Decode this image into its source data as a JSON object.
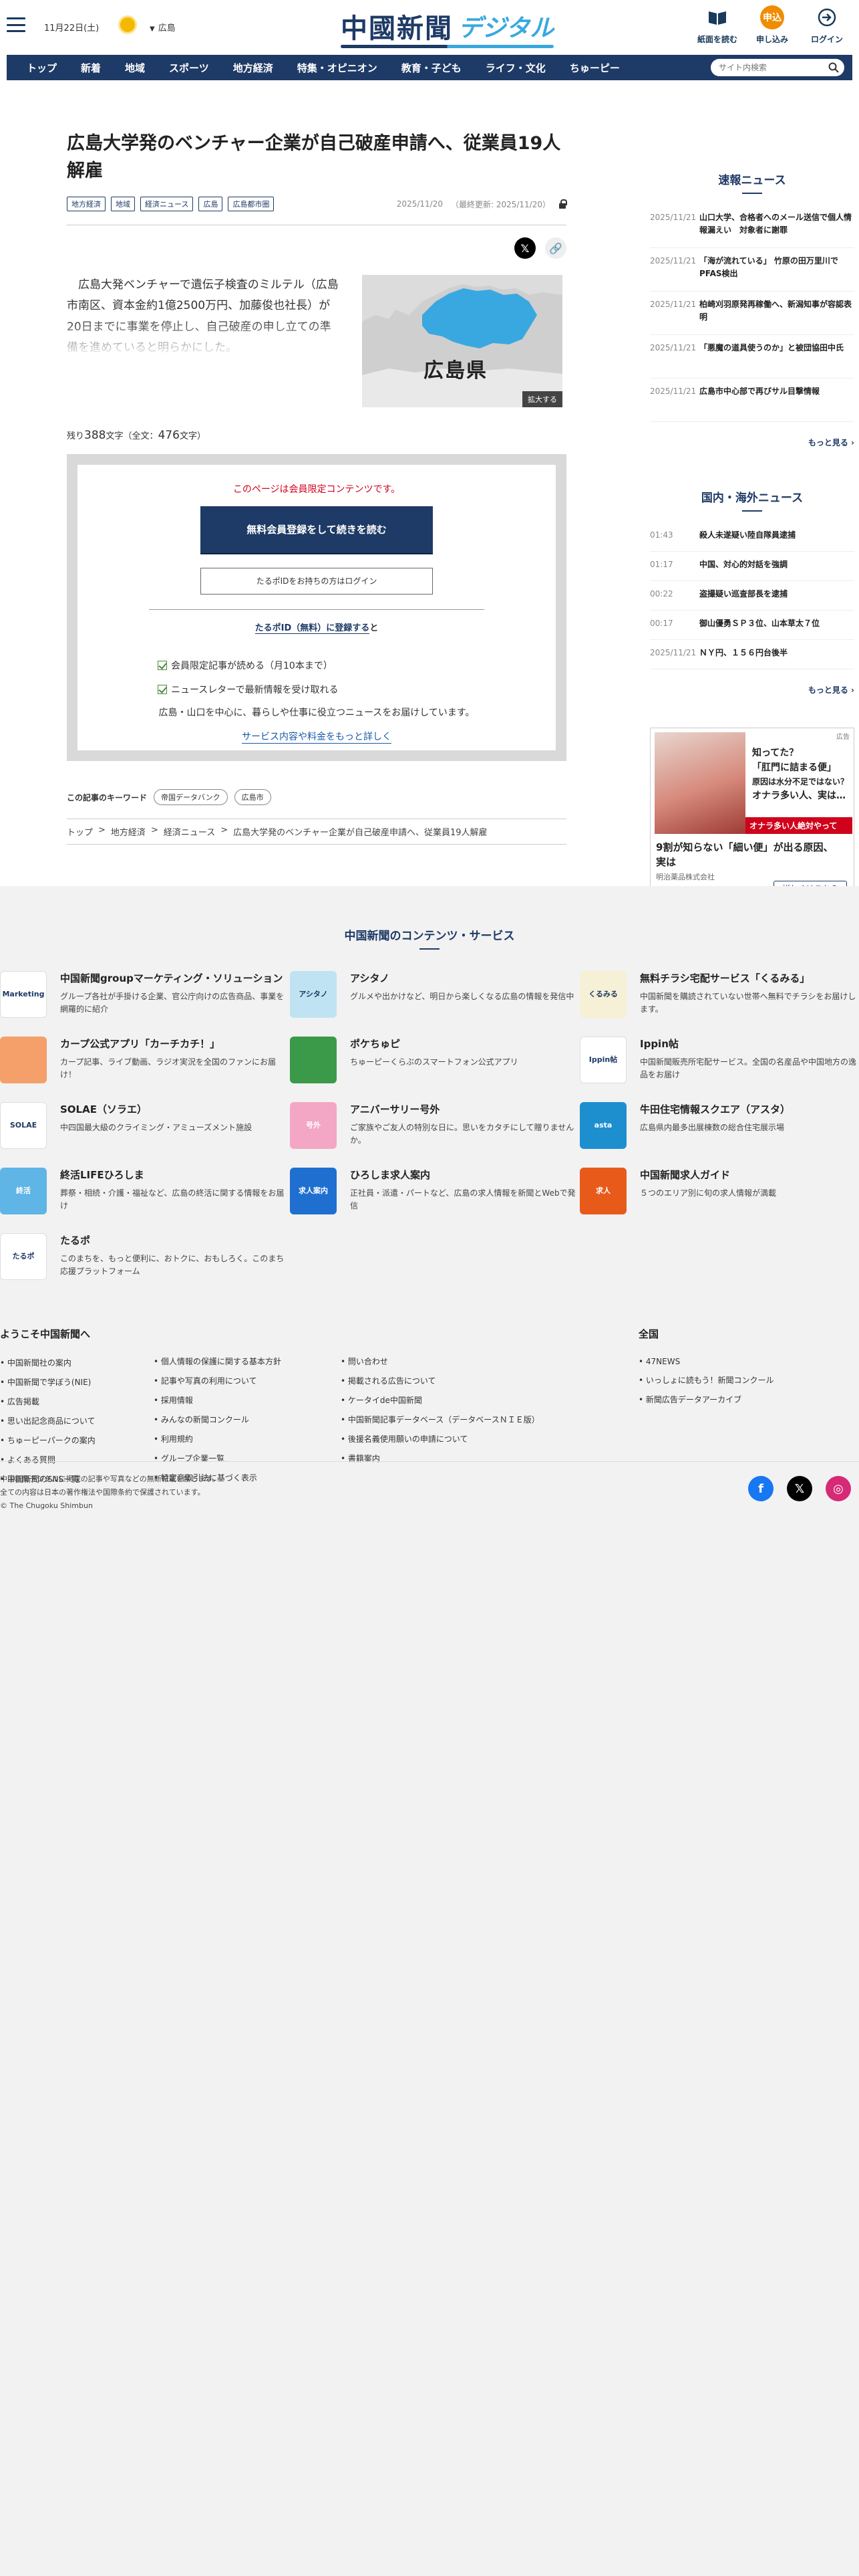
{
  "header": {
    "date": "11月22日(土)",
    "region": "広島",
    "logo_main": "中國新聞",
    "logo_sub": "デジタル",
    "tools": [
      {
        "label": "紙面を読む",
        "icon": "newspaper-icon"
      },
      {
        "label": "申し込み",
        "icon": "subscribe-icon",
        "badge": "申込"
      },
      {
        "label": "ログイン",
        "icon": "login-icon"
      }
    ]
  },
  "nav": {
    "items": [
      "トップ",
      "新着",
      "地域",
      "スポーツ",
      "地方経済",
      "特集・オピニオン",
      "教育・子ども",
      "ライフ・文化",
      "ちゅーピー"
    ],
    "search_placeholder": "サイト内検索"
  },
  "article": {
    "title": "広島大学発のベンチャー企業が自己破産申請へ、従業員19人解雇",
    "tags": [
      "地方経済",
      "地域",
      "経済ニュース",
      "広島",
      "広島都市圏"
    ],
    "date": "2025/11/20",
    "updated": "（最終更新: 2025/11/20）",
    "lead": "広島大発ベンチャーで遺伝子検査のミルテル（広島市南区、資本金約1億2500万円、加藤俊也社長）が20日までに事業を停止し、自己破産の申し立ての準備を進めていると明らかにした。",
    "map_label": "広島県",
    "zoom_label": "拡大する",
    "remaining_prefix": "残り",
    "remaining_count": "388",
    "remaining_mid": "文字（全文：",
    "total_count": "476",
    "remaining_suffix": "文字）",
    "paywall": {
      "notice": "このページは会員限定コンテンツです。",
      "register_button": "無料会員登録をして続きを読む",
      "login_button": "たるポIDをお持ちの方はログイン",
      "id_heading_link": "たるポID（無料）に登録する",
      "id_heading_rest": "と",
      "benefits": [
        "会員限定記事が読める（月10本まで）",
        "ニュースレターで最新情報を受け取れる"
      ],
      "desc": "広島・山口を中心に、暮らしや仕事に役立つニュースをお届けしています。",
      "more_link": "サービス内容や料金をもっと詳しく"
    },
    "keywords_label": "この記事のキーワード",
    "keywords": [
      "帝国データバンク",
      "広島市"
    ],
    "breadcrumb": [
      "トップ",
      "地方経済",
      "経済ニュース",
      "広島大学発のベンチャー企業が自己破産申請へ、従業員19人解雇"
    ]
  },
  "sidebar": {
    "breaking_title": "速報ニュース",
    "breaking": [
      {
        "time": "2025/11/21",
        "headline": "山口大学、合格者へのメール送信で個人情報漏えい　対象者に謝罪"
      },
      {
        "time": "2025/11/21",
        "headline": "「海が流れている」 竹原の田万里川でPFAS検出"
      },
      {
        "time": "2025/11/21",
        "headline": "柏崎刈羽原発再稼働へ、新潟知事が容認表明"
      },
      {
        "time": "2025/11/21",
        "headline": "「悪魔の道具使うのか」と被団協田中氏"
      },
      {
        "time": "2025/11/21",
        "headline": "広島市中心部で再びサル目撃情報"
      }
    ],
    "more_label": "もっと見る",
    "world_title": "国内・海外ニュース",
    "world": [
      {
        "time": "01:43",
        "headline": "殺人未遂疑い陸自隊員逮捕"
      },
      {
        "time": "01:17",
        "headline": "中国、対心的対話を強調"
      },
      {
        "time": "00:22",
        "headline": "盗撮疑い巡査部長を逮捕"
      },
      {
        "time": "00:17",
        "headline": "御山優勇ＳＰ３位、山本草太７位"
      },
      {
        "time": "2025/11/21",
        "headline": "ＮＹ円、１５６円台後半"
      }
    ],
    "world_more_label": "もっと見る",
    "ad": {
      "label": "広告",
      "text1": "知ってた？",
      "text2": "「肛門に詰まる便」",
      "text3": "原因は水分不足ではない？",
      "text4": "オナラ多い人、実は…",
      "red_banner": "オナラ多い人絶対やって",
      "headline": "9割が知らない「細い便」が出る原因、実は",
      "sponsor": "明治薬品株式会社",
      "button": "詳しくはこちら"
    }
  },
  "footer": {
    "services_title": "中国新聞のコンテンツ・サービス",
    "services": [
      {
        "title": "中国新聞groupマーケティング・ソリューション",
        "desc": "グループ各社が手掛ける企業、官公庁向けの広告商品、事業を網羅的に紹介",
        "icon": "chugoku-marketing-logo",
        "logo_text": "Marketing",
        "color": "#ffffff"
      },
      {
        "title": "アシタノ",
        "desc": "グルメや出かけなど、明日から楽しくなる広島の情報を発信中",
        "icon": "ashitano-logo",
        "logo_text": "アシタノ",
        "color": "#bfe3f2"
      },
      {
        "title": "無料チラシ宅配サービス「くるみる」",
        "desc": "中国新聞を購読されていない世帯へ無料でチラシをお届けします。",
        "icon": "kurumiru-logo",
        "logo_text": "くるみる",
        "color": "#f6f0d6"
      },
      {
        "title": "カープ公式アプリ「カーチカチ！」",
        "desc": "カープ記事、ライブ動画、ラジオ実況を全国のファンにお届け！",
        "icon": "carp-app-logo",
        "logo_text": "",
        "color": "#f5a06a"
      },
      {
        "title": "ポケちゅピ",
        "desc": "ちゅーピーくらぶのスマートフォン公式アプリ",
        "icon": "pokechupi-logo",
        "logo_text": "",
        "color": "#3a9a4a"
      },
      {
        "title": "Ippin帖",
        "desc": "中国新聞販売所宅配サービス。全国の名産品や中国地方の逸品をお届け",
        "icon": "ippincho-logo",
        "logo_text": "Ippin帖",
        "color": "#ffffff"
      },
      {
        "title": "SOLAE（ソラエ）",
        "desc": "中四国最大級のクライミング・アミューズメント施設",
        "icon": "solae-logo",
        "logo_text": "SOLAE",
        "color": "#ffffff"
      },
      {
        "title": "アニバーサリー号外",
        "desc": "ご家族やご友人の特別な日に。思いをカタチにして贈りませんか。",
        "icon": "anniversary-logo",
        "logo_text": "号外",
        "color": "#f3a7c4"
      },
      {
        "title": "牛田住宅情報スクエア（アスタ）",
        "desc": "広島県内最多出展棟数の総合住宅展示場",
        "icon": "asta-logo",
        "logo_text": "asta",
        "color": "#1d8fcf"
      },
      {
        "title": "終活LIFEひろしま",
        "desc": "葬祭・相続・介護・福祉など、広島の終活に関する情報をお届け",
        "icon": "shukatsu-logo",
        "logo_text": "終活",
        "color": "#5fb5e5"
      },
      {
        "title": "ひろしま求人案内",
        "desc": "正社員・派遣・パートなど、広島の求人情報を新聞とWebで発信",
        "icon": "hiroshima-kyujin-logo",
        "logo_text": "求人案内",
        "color": "#1e6fd0"
      },
      {
        "title": "中国新聞求人ガイド",
        "desc": "５つのエリア別に旬の求人情報が満載",
        "icon": "kyujin-guide-logo",
        "logo_text": "求人",
        "color": "#e85a1a"
      },
      {
        "title": "たるポ",
        "desc": "このまちを、もっと便利に、おトクに、おもしろく。このまち応援プラットフォーム",
        "icon": "tarupo-logo",
        "logo_text": "たるポ",
        "color": "#ffffff"
      }
    ],
    "welcome_title": "ようこそ中国新聞へ",
    "welcome_col1": [
      "中国新聞社の案内",
      "中国新聞で学ぼう(NIE)",
      "広告掲載",
      "思い出記念商品について",
      "ちゅーピーパークの案内",
      "よくある質問",
      "中国新聞のSNS一覧"
    ],
    "welcome_col2": [
      "個人情報の保護に関する基本方針",
      "記事や写真の利用について",
      "採用情報",
      "みんなの新聞コンクール",
      "利用規約",
      "グループ企業一覧",
      "特定商取引法に基づく表示"
    ],
    "welcome_col3": [
      "問い合わせ",
      "掲載される広告について",
      "ケータイde中国新聞",
      "中国新聞記事データベース（データベースＮＩＥ版）",
      "後援名義使用願いの申請について",
      "書籍案内"
    ],
    "national_title": "全国",
    "national": [
      "47NEWS",
      "いっしょに読もう！新聞コンクール",
      "新聞広告データアーカイブ"
    ],
    "copyright1": "中国新聞デジタルに掲載の記事や写真などの無断転載を禁じます。",
    "copyright2": "全ての内容は日本の著作権法や国際条約で保護されています。",
    "copyright3": "© The Chugoku Shimbun",
    "social": [
      {
        "name": "facebook-icon",
        "glyph": "f",
        "color": "#1877f2"
      },
      {
        "name": "x-icon",
        "glyph": "𝕏",
        "color": "#000000"
      },
      {
        "name": "instagram-icon",
        "glyph": "◎",
        "color": "#d62976"
      }
    ]
  }
}
